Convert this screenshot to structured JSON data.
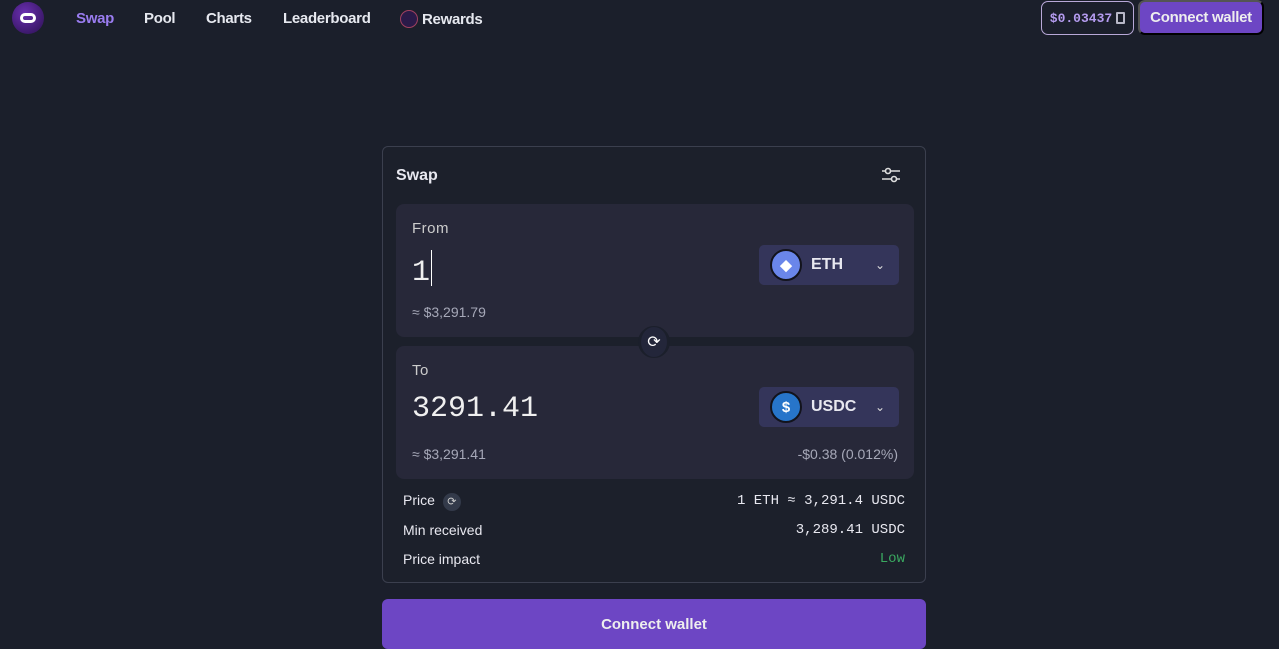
{
  "nav": {
    "items": [
      "Swap",
      "Pool",
      "Charts",
      "Leaderboard",
      "Rewards"
    ],
    "gas_price": "$0.03437",
    "connect_label": "Connect wallet"
  },
  "swap": {
    "title": "Swap",
    "from": {
      "label": "From",
      "amount": "1",
      "usd": "≈ $3,291.79",
      "token": "ETH"
    },
    "to": {
      "label": "To",
      "amount": "3291.41",
      "usd": "≈ $3,291.41",
      "diff": "-$0.38 (0.012%)",
      "token": "USDC"
    },
    "details": [
      {
        "label": "Price",
        "value": "1 ETH ≈ 3,291.4 USDC"
      },
      {
        "label": "Min received",
        "value": "3,289.41 USDC"
      },
      {
        "label": "Price impact",
        "value": "Low"
      }
    ],
    "connect_label": "Connect wallet"
  },
  "colors": {
    "accent": "#6d46c4",
    "low": "#3aa860"
  }
}
